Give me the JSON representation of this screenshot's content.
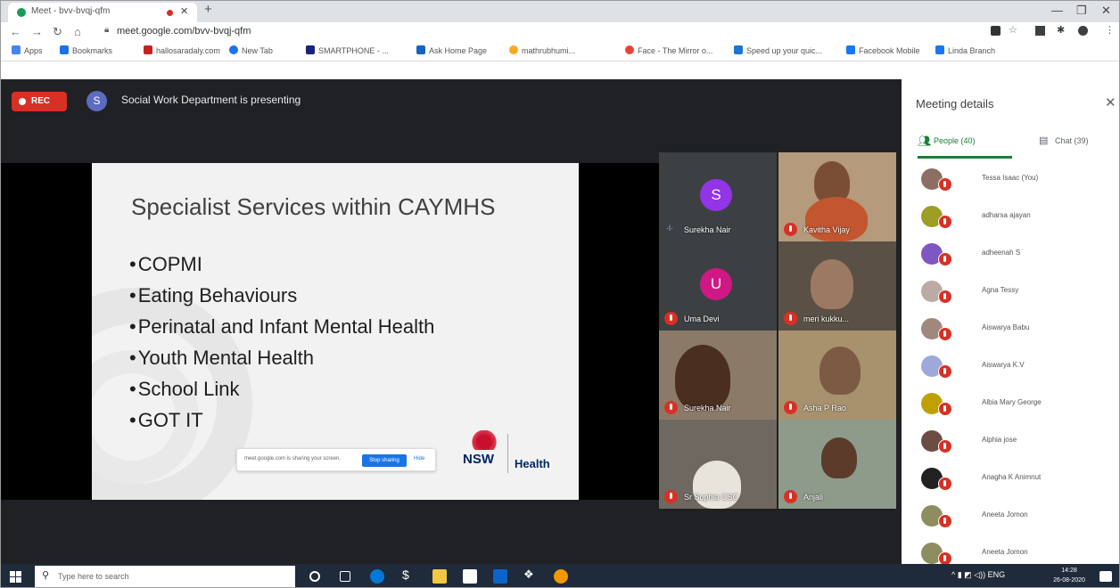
{
  "browser": {
    "tab_title": "Meet - bvv-bvqj-qfm",
    "url": "meet.google.com/bvv-bvqj-qfm",
    "bookmarks": [
      {
        "label": "Apps",
        "color": "#4285f4"
      },
      {
        "label": "Bookmarks",
        "color": "#1a73e8"
      },
      {
        "label": "hallosaradaly.com",
        "color": "#c5221f"
      },
      {
        "label": "New Tab",
        "color": "#1a73e8"
      },
      {
        "label": "SMARTPHONE - ...",
        "color": "#1a237e"
      },
      {
        "label": "Ask Home Page",
        "color": "#1565c0"
      },
      {
        "label": "mathrubhumi...",
        "color": "#f9a825"
      },
      {
        "label": "Face - The Mirror o...",
        "color": "#ea4335"
      },
      {
        "label": "Speed up your quic...",
        "color": "#1976d2"
      },
      {
        "label": "Facebook Mobile",
        "color": "#1877f2"
      },
      {
        "label": "Linda Branch",
        "color": "#1877f2"
      }
    ]
  },
  "meet": {
    "rec_label": "REC",
    "presenter_initial": "S",
    "presenting_text": "Social Work Department is presenting",
    "slide": {
      "title": "Specialist Services within CAYMHS",
      "bullets": [
        "COPMI",
        "Eating Behaviours",
        "Perinatal and Infant Mental Health",
        "Youth Mental Health",
        "School Link",
        "GOT IT"
      ],
      "sharing_text": "meet.google.com is sharing your screen.",
      "stop_sharing": "Stop sharing",
      "hide": "Hide",
      "logo_text": "NSW",
      "health_text": "Health"
    },
    "tiles": [
      {
        "name": "Surekha Nair",
        "initial": "S",
        "avatar_color": "#9334e6"
      },
      {
        "name": "Kavitha Vijay"
      },
      {
        "name": "Uma Devi",
        "initial": "U",
        "avatar_color": "#d01884"
      },
      {
        "name": "meri kukku..."
      },
      {
        "name": "Surekha Nair"
      },
      {
        "name": "Asha P Rao"
      },
      {
        "name": "Sr Sophia CSC"
      },
      {
        "name": "Anjali"
      }
    ]
  },
  "panel": {
    "title": "Meeting details",
    "people_tab": "People (40)",
    "chat_tab": "Chat (39)",
    "people": [
      {
        "name": "Tessa Isaac (You)",
        "color": "#8d6e63"
      },
      {
        "name": "adharsa ajayan",
        "color": "#9e9d24"
      },
      {
        "name": "adheenah S",
        "color": "#7e57c2"
      },
      {
        "name": "Agna Tessy",
        "color": "#bcaaa4"
      },
      {
        "name": "Aiswarya Babu",
        "color": "#a1887f"
      },
      {
        "name": "Aiswarya K.V",
        "color": "#9fa8da"
      },
      {
        "name": "Albia Mary George",
        "color": "#c0a000"
      },
      {
        "name": "Alphia jose",
        "color": "#6d4c41"
      },
      {
        "name": "Anagha K Animnut",
        "color": "#212121"
      },
      {
        "name": "Aneeta Jomon",
        "color": "#8d8d5f"
      },
      {
        "name": "Aneeta Jomon",
        "color": "#8d8d5f"
      }
    ]
  },
  "taskbar": {
    "search_placeholder": "Type here to search",
    "tray": "ENG",
    "time": "14:28",
    "date": "26-08-2020"
  }
}
